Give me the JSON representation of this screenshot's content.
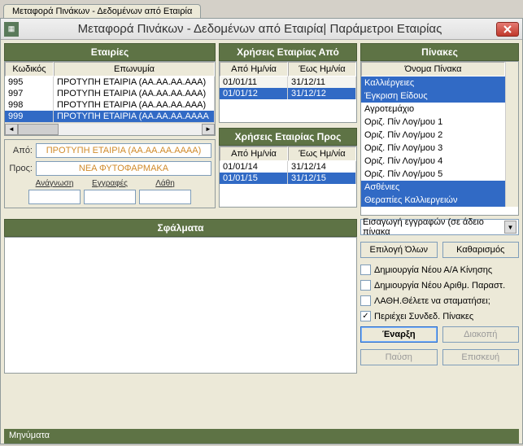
{
  "tab_title": "Μεταφορά Πινάκων - Δεδομένων από Εταιρία",
  "window_title": "Μεταφορά Πινάκων - Δεδομένων από Εταιρία| Παράμετροι Εταιρίας",
  "companies": {
    "head": "Εταιρίες",
    "cols": {
      "code": "Κωδικός",
      "name": "Επωνυμία"
    },
    "rows": [
      {
        "code": "995",
        "name": "ΠΡΟΤΥΠΗ ΕΤΑΙΡΙΑ (ΑΑ.ΑΑ.ΑΑ.ΑΑΑ)"
      },
      {
        "code": "997",
        "name": "ΠΡΟΤΥΠΗ ΕΤΑΙΡΙΑ (ΑΑ.ΑΑ.ΑΑ.ΑΑΑ)"
      },
      {
        "code": "998",
        "name": "ΠΡΟΤΥΠΗ ΕΤΑΙΡΙΑ (ΑΑ.ΑΑ.ΑΑ.ΑΑΑ)"
      },
      {
        "code": "999",
        "name": "ΠΡΟΤΥΠΗ ΕΤΑΙΡΙΑ (ΑΑ.ΑΑ.ΑΑ.ΑΑΑΑ"
      }
    ],
    "selected_index": 3
  },
  "source": {
    "from_lbl": "Από:",
    "from_val": "ΠΡΟΤΥΠΗ ΕΤΑΙΡΙΑ (ΑΑ.ΑΑ.ΑΑ.ΑΑΑΑ)",
    "to_lbl": "Προς:",
    "to_val": "ΝΕΑ ΦΥΤΟΦΑΡΜΑΚΑ"
  },
  "counters": {
    "read": "Ανάγνωση",
    "writes": "Εγγραφές",
    "errs": "Λάθη"
  },
  "uses_from": {
    "head": "Χρήσεις Εταιρίας Από",
    "cols": {
      "from": "Από Ημ/νία",
      "to": "Έως Ημ/νία"
    },
    "rows": [
      {
        "from": "01/01/11",
        "to": "31/12/11"
      },
      {
        "from": "01/01/12",
        "to": "31/12/12"
      }
    ],
    "selected_index": 1
  },
  "uses_to": {
    "head": "Χρήσεις Εταιρίας Προς",
    "cols": {
      "from": "Από Ημ/νία",
      "to": "Έως Ημ/νία"
    },
    "rows": [
      {
        "from": "01/01/14",
        "to": "31/12/14"
      },
      {
        "from": "01/01/15",
        "to": "31/12/15"
      }
    ],
    "selected_index": 1
  },
  "errors_head": "Σφάλματα",
  "tables": {
    "head": "Πίνακες",
    "col": "Όνομα Πίνακα",
    "items": [
      {
        "name": "Καλλιέργειες",
        "sel": true
      },
      {
        "name": "Έγκριση Είδους",
        "sel": true
      },
      {
        "name": "Αγροτεμάχιο",
        "sel": false
      },
      {
        "name": "Οριζ. Πίν Λογ/μου 1",
        "sel": false
      },
      {
        "name": "Οριζ. Πίν Λογ/μου 2",
        "sel": false
      },
      {
        "name": "Οριζ. Πίν Λογ/μου 3",
        "sel": false
      },
      {
        "name": "Οριζ. Πίν Λογ/μου 4",
        "sel": false
      },
      {
        "name": "Οριζ. Πίν Λογ/μου 5",
        "sel": false
      },
      {
        "name": "Ασθένιες",
        "sel": true
      },
      {
        "name": "Θεραπίες Καλλιεργειών",
        "sel": true
      }
    ]
  },
  "insert_mode": "Εισαγωγή εγγραφών (σε άδειο πίνακα",
  "buttons": {
    "select_all": "Επιλογή Όλων",
    "clear": "Καθαρισμός",
    "start": "Έναρξη",
    "stop": "Διακοπή",
    "pause": "Παύση",
    "repair": "Επισκευή"
  },
  "checks": {
    "new_aa": {
      "label": "Δημιουργία Νέου Α/Α Κίνησης",
      "checked": false
    },
    "new_doc": {
      "label": "Δημιουργία Νέου Αριθμ. Παραστ.",
      "checked": false
    },
    "stop_err": {
      "label": "ΛΑΘΗ.Θέλετε να σταματήσει;",
      "checked": false
    },
    "linked": {
      "label": "Περιέχει Συνδεδ.  Πίνακες",
      "checked": true
    }
  },
  "footer": "Μηνύματα"
}
